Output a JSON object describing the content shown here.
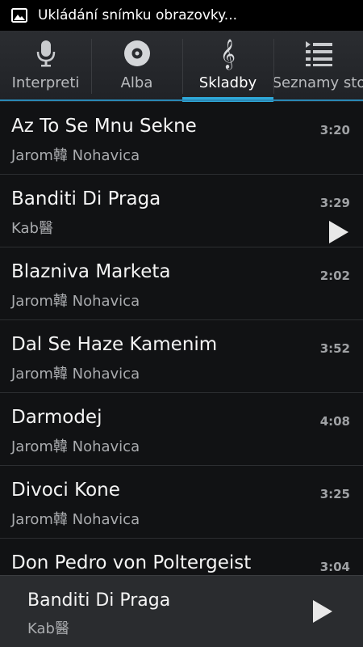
{
  "status_bar": {
    "notification_icon": "image-icon",
    "text": "Ukládání snímku obrazovky..."
  },
  "tabs": [
    {
      "label": "Interpreti",
      "icon": "microphone-icon",
      "active": false
    },
    {
      "label": "Alba",
      "icon": "disc-icon",
      "active": false
    },
    {
      "label": "Skladby",
      "icon": "treble-clef-icon",
      "active": true
    },
    {
      "label": "Seznamy sto",
      "icon": "playlist-icon",
      "active": false
    }
  ],
  "tracks": [
    {
      "title": "Az To Se Mnu Sekne",
      "artist": "Jarom韓 Nohavica",
      "duration": "3:20",
      "playing": false
    },
    {
      "title": "Banditi Di Praga",
      "artist": "Kab醫",
      "duration": "3:29",
      "playing": true
    },
    {
      "title": "Blazniva Marketa",
      "artist": "Jarom韓 Nohavica",
      "duration": "2:02",
      "playing": false
    },
    {
      "title": "Dal Se Haze Kamenim",
      "artist": "Jarom韓 Nohavica",
      "duration": "3:52",
      "playing": false
    },
    {
      "title": "Darmodej",
      "artist": "Jarom韓 Nohavica",
      "duration": "4:08",
      "playing": false
    },
    {
      "title": "Divoci Kone",
      "artist": "Jarom韓 Nohavica",
      "duration": "3:25",
      "playing": false
    },
    {
      "title": "Don Pedro von Poltergeist",
      "artist": "",
      "duration": "3:04",
      "playing": false
    }
  ],
  "now_playing": {
    "title": "Banditi Di Praga",
    "artist": "Kab醫",
    "control_icon": "play-icon"
  },
  "colors": {
    "accent": "#2fa8d8",
    "background": "#111214",
    "status_bar": "#000000",
    "now_playing_bar": "#2a2c2f"
  }
}
